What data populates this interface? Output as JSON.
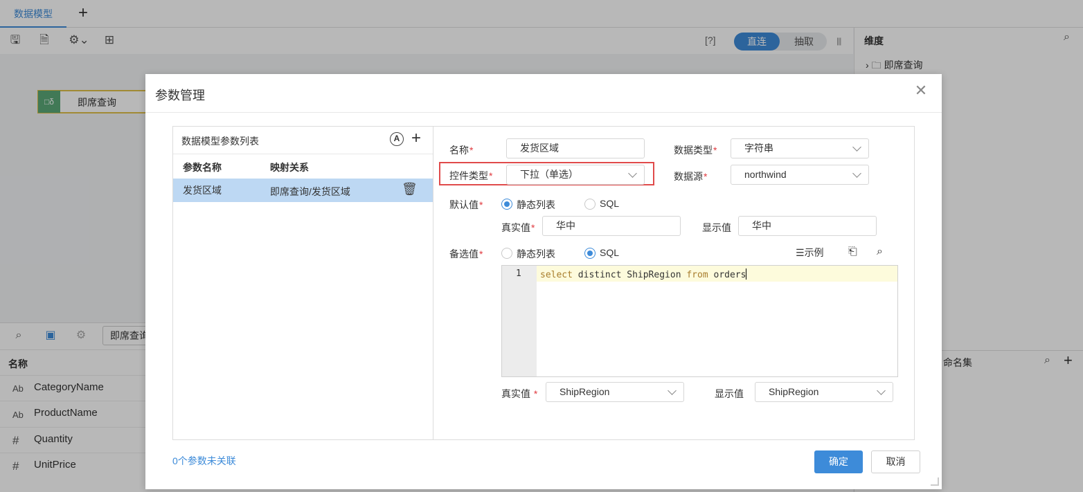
{
  "app": {
    "tab_label": "数据模型",
    "tab_add": "+",
    "help": "[?]",
    "mode_direct": "直连",
    "mode_extract": "抽取",
    "canvas_node": "即席查询",
    "node_badge": "□δ"
  },
  "right_panel": {
    "title": "维度",
    "tree_item": "即席查询",
    "named_sets": "命名集"
  },
  "lower_panel": {
    "selected_source": "即席查询",
    "header": "名称",
    "fields": [
      {
        "type_icon": "Ab",
        "name": "CategoryName"
      },
      {
        "type_icon": "Ab",
        "name": "ProductName"
      },
      {
        "type_icon": "#",
        "name": "Quantity"
      },
      {
        "type_icon": "#",
        "name": "UnitPrice"
      }
    ]
  },
  "dialog": {
    "title": "参数管理",
    "list_title": "数据模型参数列表",
    "col_param": "参数名称",
    "col_mapping": "映射关系",
    "rows": [
      {
        "name": "发货区域",
        "mapping": "即席查询/发货区域"
      }
    ],
    "unlinked": "0个参数未关联",
    "ok": "确定",
    "cancel": "取消"
  },
  "form": {
    "name_label": "名称",
    "name_value": "发货区域",
    "datatype_label": "数据类型",
    "datatype_value": "字符串",
    "control_label": "控件类型",
    "control_value": "下拉（单选）",
    "datasource_label": "数据源",
    "datasource_value": "northwind",
    "default_label": "默认值",
    "default_opt_static": "静态列表",
    "default_opt_sql": "SQL",
    "default_selected": "静态列表",
    "real_value_label": "真实值",
    "real_value": "华中",
    "display_value_label": "显示值",
    "display_value": "华中",
    "options_label": "备选值",
    "options_opt_static": "静态列表",
    "options_opt_sql": "SQL",
    "options_selected": "SQL",
    "example_label": "示例",
    "sql_line_no": "1",
    "sql_code": "select distinct ShipRegion from orders",
    "bottom_real_label": "真实值",
    "bottom_real_value": "ShipRegion",
    "bottom_display_label": "显示值",
    "bottom_display_value": "ShipRegion"
  },
  "colors": {
    "accent": "#3d8bd9",
    "required": "#e0393e",
    "highlight_box": "#e04a4a",
    "selected_row": "#bdd8f3"
  }
}
